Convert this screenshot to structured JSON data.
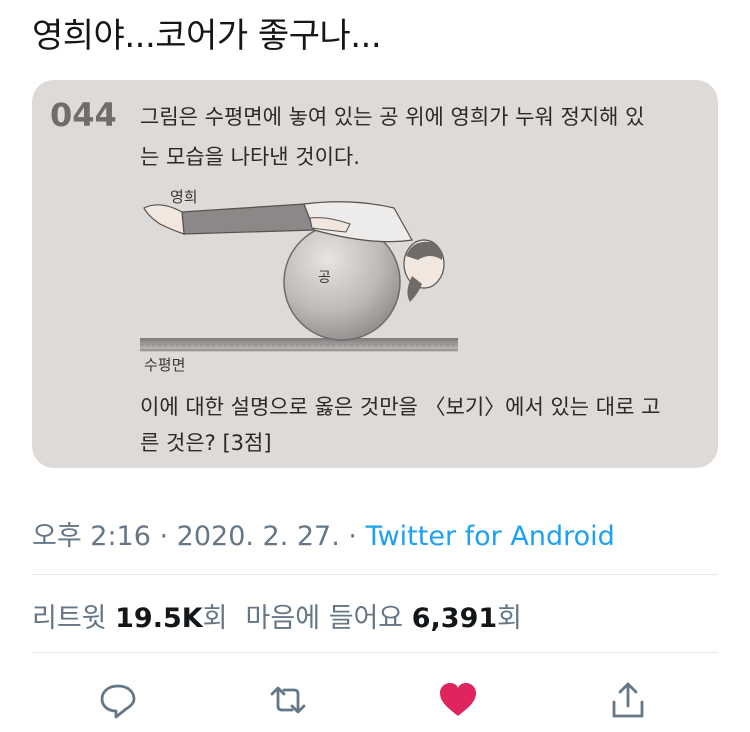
{
  "tweet": {
    "text": "영희야...코어가 좋구나..."
  },
  "photo": {
    "problem_number": "044",
    "question_line1": "그림은 수평면에 놓여 있는 공 위에 영희가 누워 정지해 있",
    "question_line2": "는 모습을 나타낸 것이다.",
    "label_person": "영희",
    "label_ball": "공",
    "label_surface": "수평면",
    "prompt_line1": "이에 대한 설명으로 옳은 것만을 〈보기〉에서 있는 대로 고",
    "prompt_line2": "른 것은? [3점]"
  },
  "meta": {
    "time": "오후 2:16",
    "date": "2020. 2. 27.",
    "separator": " · ",
    "source": "Twitter for Android"
  },
  "stats": {
    "retweets_label": "리트윗",
    "retweets_count": "19.5K",
    "retweets_unit": "회",
    "likes_label": "마음에 들어요",
    "likes_count": "6,391",
    "likes_unit": "회"
  },
  "actions": {
    "reply_icon": "speech-bubble-icon",
    "retweet_icon": "retweet-arrows-icon",
    "like_icon": "heart-icon",
    "share_icon": "share-upload-icon",
    "like_color": "#e0245e",
    "icon_color": "#657786"
  }
}
